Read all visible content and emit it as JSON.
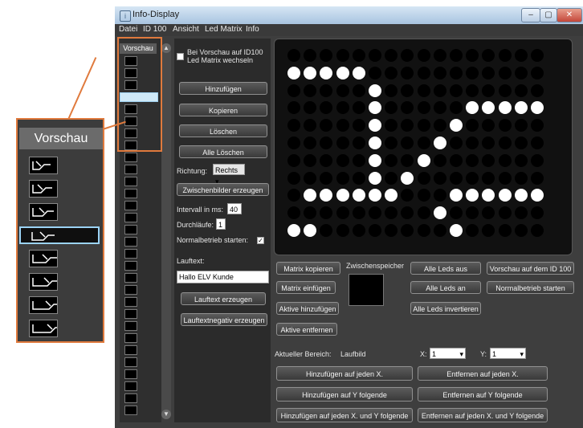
{
  "window": {
    "title": "Info-Display",
    "icon": "app-icon",
    "controls": [
      "–",
      "▢",
      "✕"
    ]
  },
  "menu": [
    "Datei",
    "ID 100",
    "Ansicht",
    "Led Matrix",
    "Info"
  ],
  "preview": {
    "header": "Vorschau",
    "thumbnail_count": 30,
    "selected_index": 3
  },
  "callout": {
    "header": "Vorschau",
    "thumbnail_count": 8,
    "selected_index": 3
  },
  "controls": {
    "switch_checkbox_label": "Bei Vorschau auf ID100 Led Matrix wechseln",
    "switch_checked": false,
    "add": "Hinzufügen",
    "copy": "Kopieren",
    "delete": "Löschen",
    "delete_all": "Alle Löschen",
    "direction_label": "Richtung:",
    "direction_value": "Rechts",
    "intermediate": "Zwischenbilder erzeugen",
    "interval_label": "Intervall in ms:",
    "interval_value": "40",
    "runs_label": "Durchläufe:",
    "runs_value": "1",
    "normal_label": "Normalbetrieb starten:",
    "normal_checked": true,
    "ticker_label": "Lauftext:",
    "ticker_value": "Hallo ELV Kunde",
    "ticker_create": "Lauftext erzeugen",
    "ticker_negative": "Lauftextnegativ erzeugen"
  },
  "matrix": {
    "rows": [
      "0000000000000000",
      "1111100000000000",
      "0000010000000000",
      "0000010000011111",
      "0000010000100000",
      "0000010001000000",
      "0000010010000000",
      "0000010100000000",
      "0111111000111111",
      "0000000001000000",
      "1100000000100000"
    ]
  },
  "actions": {
    "copy_matrix": "Matrix kopieren",
    "clipboard_label": "Zwischenspeicher",
    "all_off": "Alle Leds aus",
    "preview_id100": "Vorschau auf dem ID 100",
    "paste_matrix": "Matrix einfügen",
    "all_on": "Alle Leds an",
    "normal_start": "Normalbetrieb starten",
    "add_active": "Aktive hinzufügen",
    "invert_all": "Alle Leds invertieren",
    "remove_active": "Aktive entfernen"
  },
  "range": {
    "label": "Aktueller Bereich:",
    "value": "Laufbild",
    "x_label": "X:",
    "x_value": "1",
    "y_label": "Y:",
    "y_value": "1"
  },
  "bottom_buttons": {
    "add_every_x": "Hinzufügen auf jeden X.",
    "remove_every_x": "Entfernen auf jeden X.",
    "add_y_following": "Hinzufügen auf Y folgende",
    "remove_y_following": "Entfernen auf Y folgende",
    "add_x_and_y": "Hinzufügen auf jeden X. und Y folgende",
    "remove_x_and_y": "Entfernen auf jeden X. und Y folgende"
  },
  "colors": {
    "highlight": "#e07a3d",
    "selection": "#9bd3f5",
    "led_on": "#ffffff",
    "led_off": "#000000"
  }
}
